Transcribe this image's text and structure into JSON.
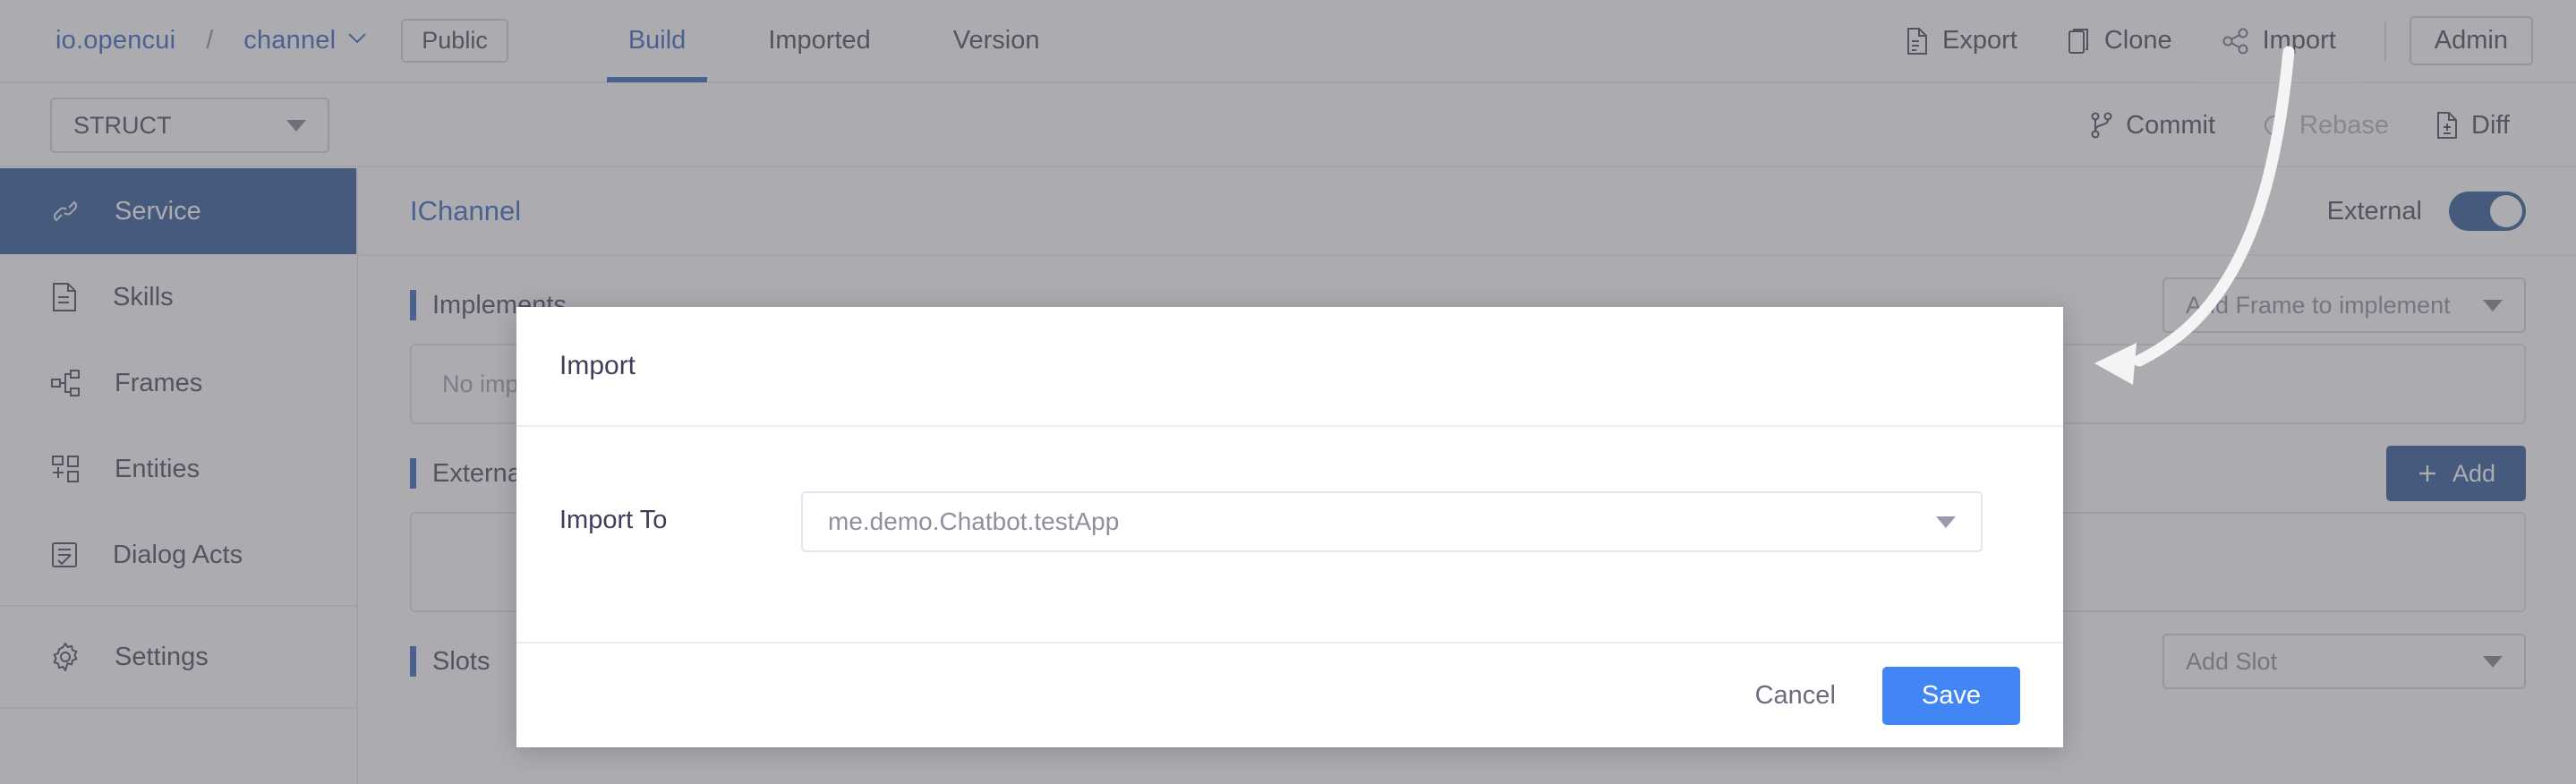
{
  "topbar": {
    "breadcrumb": {
      "org": "io.opencui",
      "separator": "/",
      "project": "channel",
      "caret": "chevron-down-icon",
      "visibility_badge": "Public"
    },
    "tabs": [
      {
        "label": "Build",
        "active": true
      },
      {
        "label": "Imported",
        "active": false
      },
      {
        "label": "Version",
        "active": false
      }
    ],
    "actions": [
      {
        "label": "Export",
        "icon": "file-export-icon",
        "highlighted": false
      },
      {
        "label": "Clone",
        "icon": "copy-icon",
        "highlighted": false
      },
      {
        "label": "Import",
        "icon": "share-nodes-icon",
        "highlighted": true
      }
    ],
    "admin_label": "Admin"
  },
  "subbar": {
    "struct_select": {
      "value": "STRUCT",
      "icon": "chevron-down-icon"
    },
    "actions": [
      {
        "label": "Commit",
        "icon": "git-branch-icon",
        "disabled": false
      },
      {
        "label": "Rebase",
        "icon": "refresh-icon",
        "disabled": true
      },
      {
        "label": "Diff",
        "icon": "file-diff-icon",
        "disabled": false
      }
    ]
  },
  "sidebar": {
    "items": [
      {
        "label": "Service",
        "icon": "link-icon",
        "active": true
      },
      {
        "label": "Skills",
        "icon": "document-icon",
        "active": false
      },
      {
        "label": "Frames",
        "icon": "sitemap-icon",
        "active": false
      },
      {
        "label": "Entities",
        "icon": "grid-plus-icon",
        "active": false
      },
      {
        "label": "Dialog Acts",
        "icon": "message-list-icon",
        "active": false
      },
      {
        "label": "Settings",
        "icon": "gear-icon",
        "active": false
      }
    ]
  },
  "main": {
    "title": "IChannel",
    "external": {
      "label": "External",
      "enabled": true
    },
    "sections": [
      {
        "title": "Implements",
        "select_placeholder": "Add Frame to implement",
        "empty_text": "No implementation"
      },
      {
        "title": "External",
        "add_button": "Add",
        "add_icon": "plus-icon",
        "empty_text": ""
      },
      {
        "title": "Slots",
        "select_placeholder": "Add Slot"
      }
    ]
  },
  "modal": {
    "title": "Import",
    "field_label": "Import To",
    "select_value": "me.demo.Chatbot.testApp",
    "select_caret": "chevron-down-icon",
    "cancel_label": "Cancel",
    "save_label": "Save"
  },
  "annotation": {
    "type": "curved-arrow",
    "from": "Import toolbar button",
    "to": "Add Frame to implement dropdown area"
  },
  "colors": {
    "accent_blue": "#2a5cb8",
    "sidebar_active": "#1e4c8f",
    "save_blue": "#4285f4",
    "text": "#3d3d52",
    "muted": "#8a8a98"
  }
}
